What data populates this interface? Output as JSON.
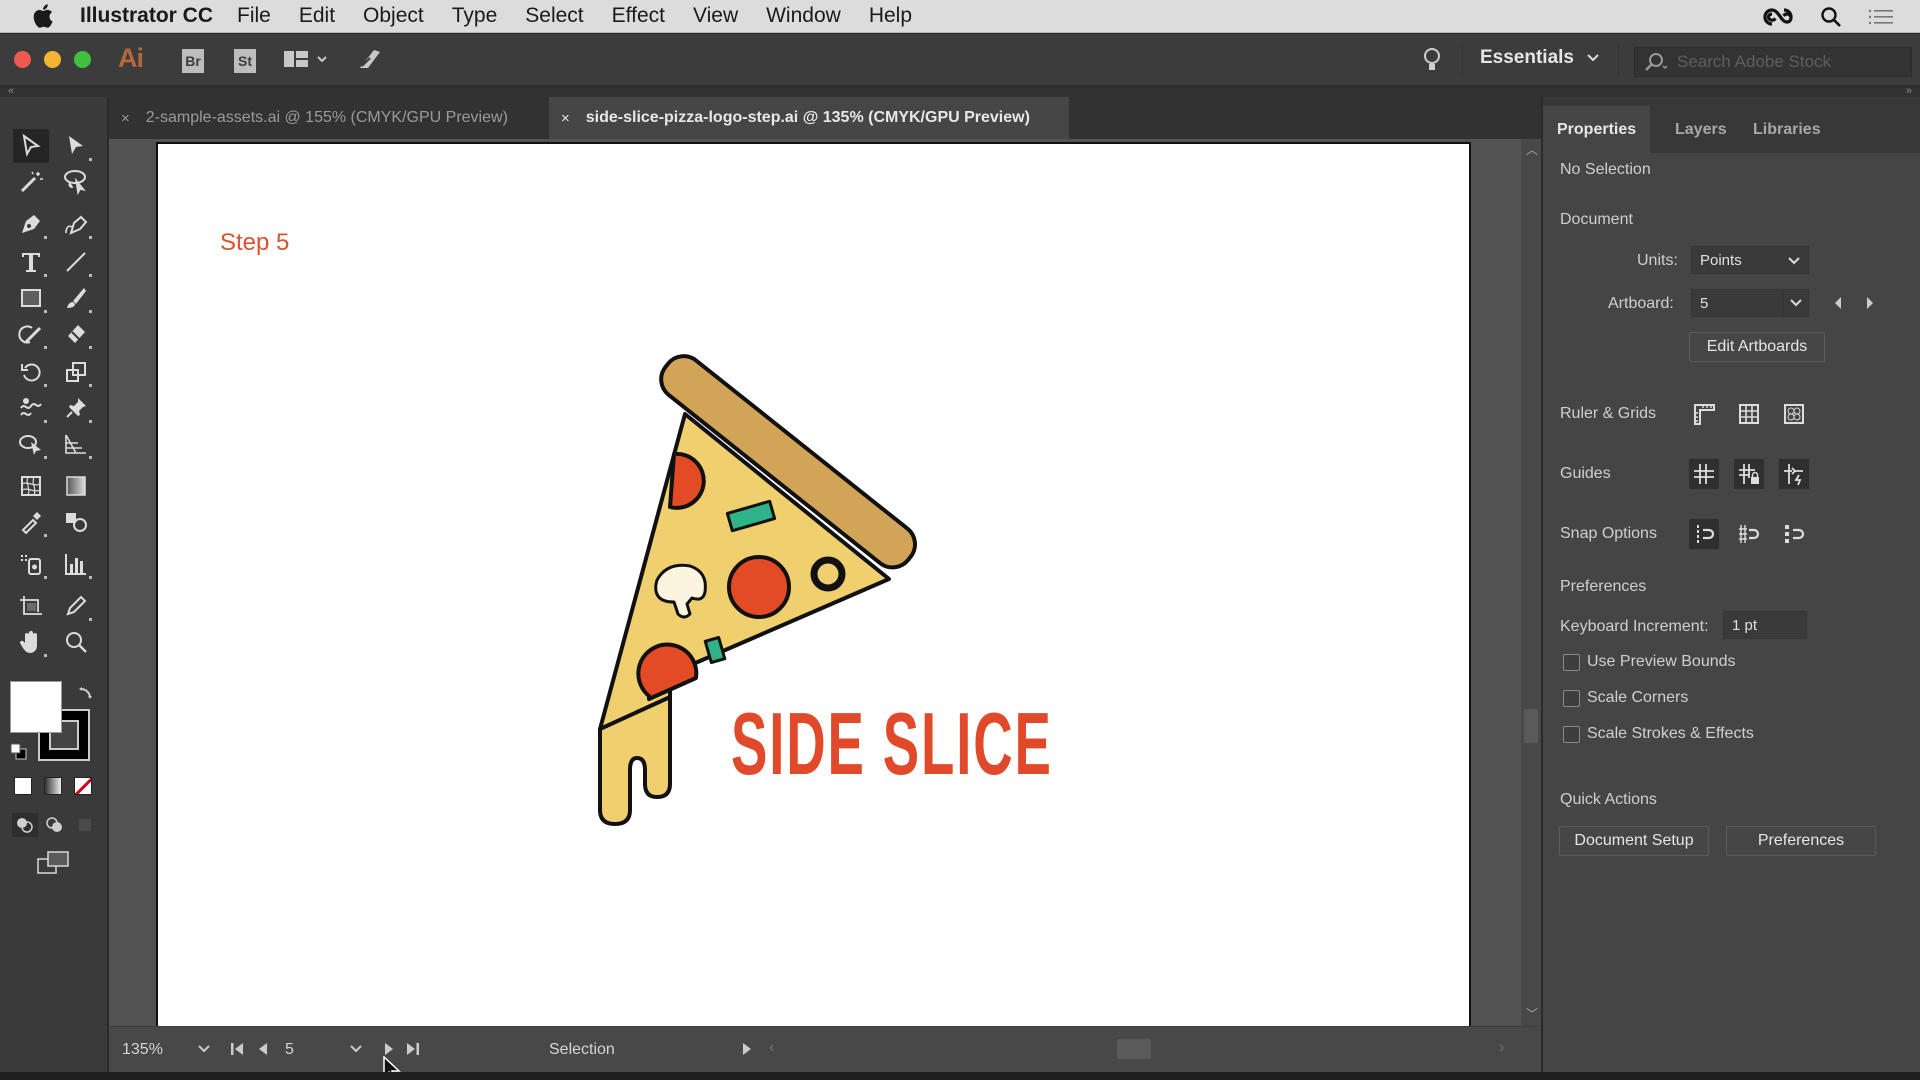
{
  "menubar": {
    "app_name": "Illustrator CC",
    "items": [
      "File",
      "Edit",
      "Object",
      "Type",
      "Select",
      "Effect",
      "View",
      "Window",
      "Help"
    ]
  },
  "appbar": {
    "logo": "Ai",
    "bridge_label": "Br",
    "stock_label": "St",
    "workspace": "Essentials",
    "search_placeholder": "Search Adobe Stock"
  },
  "tabs": [
    {
      "label": "2-sample-assets.ai @ 155% (CMYK/GPU Preview)",
      "active": false
    },
    {
      "label": "side-slice-pizza-logo-step.ai @ 135% (CMYK/GPU Preview)",
      "active": true
    }
  ],
  "artboard": {
    "step_label": "Step 5",
    "logo_text": "SIDE SLICE"
  },
  "colors": {
    "crust": "#d1a457",
    "cheese": "#f0cf6f",
    "pepperoni": "#e34b27",
    "pepper": "#2fb389",
    "mushroom": "#fbf4de",
    "outline": "#111111",
    "logo_text": "#e0492a"
  },
  "statusbar": {
    "zoom": "135%",
    "artboard_number": "5",
    "tool_name": "Selection"
  },
  "panel": {
    "tabs": [
      "Properties",
      "Layers",
      "Libraries"
    ],
    "selection_status": "No Selection",
    "document_heading": "Document",
    "units_label": "Units:",
    "units_value": "Points",
    "artboard_label": "Artboard:",
    "artboard_value": "5",
    "edit_artboards": "Edit Artboards",
    "ruler_grids": "Ruler & Grids",
    "guides": "Guides",
    "snap_options": "Snap Options",
    "preferences_heading": "Preferences",
    "keyboard_increment_label": "Keyboard Increment:",
    "keyboard_increment_value": "1 pt",
    "checkboxes": [
      {
        "label": "Use Preview Bounds",
        "checked": false
      },
      {
        "label": "Scale Corners",
        "checked": false
      },
      {
        "label": "Scale Strokes & Effects",
        "checked": false
      }
    ],
    "quick_actions_heading": "Quick Actions",
    "document_setup_button": "Document Setup",
    "preferences_button": "Preferences"
  }
}
